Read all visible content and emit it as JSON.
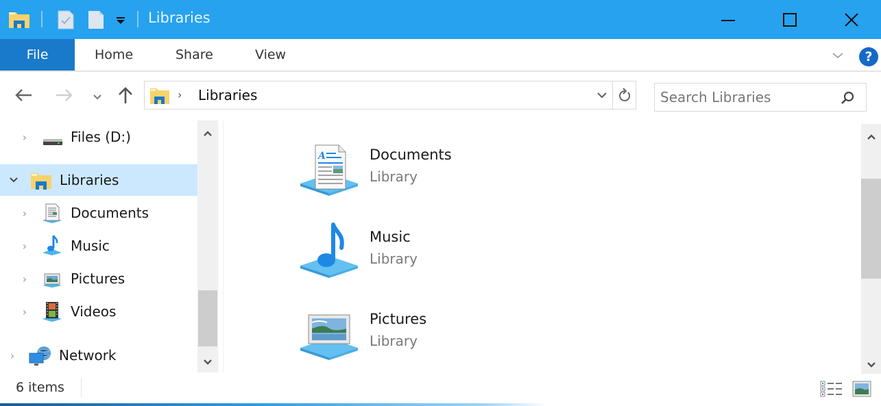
{
  "window": {
    "title": "Libraries",
    "minimize_label": "Minimize",
    "maximize_label": "Maximize",
    "close_label": "Close"
  },
  "ribbon": {
    "tabs": [
      {
        "label": "File",
        "active": true
      },
      {
        "label": "Home"
      },
      {
        "label": "Share"
      },
      {
        "label": "View"
      }
    ],
    "help_icon": "?"
  },
  "nav": {
    "breadcrumb_root_icon": "libraries-folder-icon",
    "breadcrumb": [
      "Libraries"
    ],
    "search_placeholder": "Search Libraries"
  },
  "tree": {
    "items": [
      {
        "label": "Files (D:)",
        "icon": "drive-icon",
        "expanded": false
      },
      {
        "label": "Libraries",
        "icon": "libraries-icon",
        "expanded": true,
        "selected": true
      },
      {
        "label": "Documents",
        "icon": "documents-icon",
        "expanded": false
      },
      {
        "label": "Music",
        "icon": "music-icon",
        "expanded": false
      },
      {
        "label": "Pictures",
        "icon": "pictures-icon",
        "expanded": false
      },
      {
        "label": "Videos",
        "icon": "videos-icon",
        "expanded": false
      },
      {
        "label": "Network",
        "icon": "network-icon",
        "expanded": false
      }
    ]
  },
  "content": {
    "items": [
      {
        "name": "Documents",
        "type": "Library",
        "icon": "documents-library-icon"
      },
      {
        "name": "Music",
        "type": "Library",
        "icon": "music-library-icon"
      },
      {
        "name": "Pictures",
        "type": "Library",
        "icon": "pictures-library-icon"
      }
    ]
  },
  "status": {
    "item_count": "6 items"
  },
  "colors": {
    "titlebar": "#26a2ef",
    "file_tab": "#1979ca",
    "selection": "#cce8ff"
  }
}
